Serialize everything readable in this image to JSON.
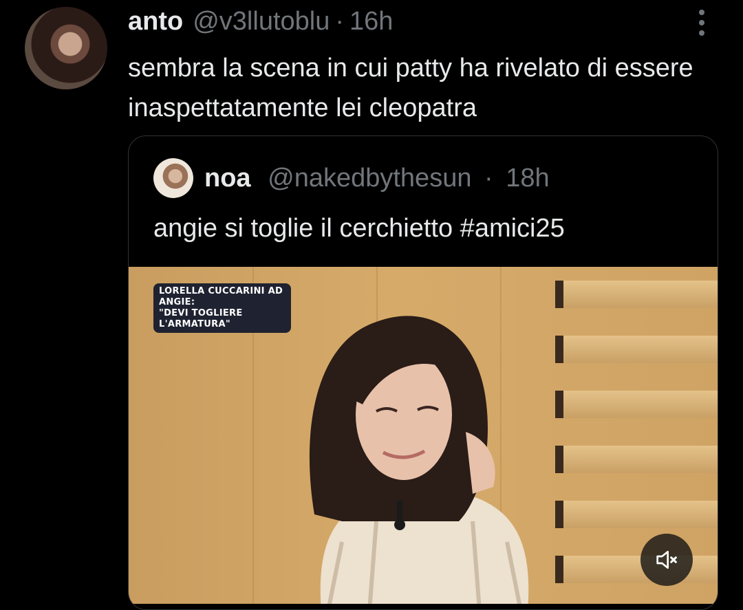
{
  "tweet": {
    "author_name": "anto",
    "author_handle": "@v3llutoblu",
    "separator": "·",
    "time": "16h",
    "text": "sembra la scena in cui patty ha rivelato di essere inaspettatamente lei cleopatra"
  },
  "quoted_tweet": {
    "author_name": "noa",
    "author_handle": "@nakedbythesun",
    "separator": "·",
    "time": "18h",
    "text": "angie si toglie il cerchietto #amici25",
    "media": {
      "caption_line1": "LORELLA CUCCARINI AD ANGIE:",
      "caption_line2": "\"DEVI TOGLIERE L'ARMATURA\""
    }
  },
  "icons": {
    "more": "more-vertical-icon",
    "mute": "speaker-muted-icon"
  },
  "colors": {
    "background": "#000000",
    "text_primary": "#e7e9ea",
    "text_secondary": "#71767b",
    "border": "#2f3336"
  }
}
